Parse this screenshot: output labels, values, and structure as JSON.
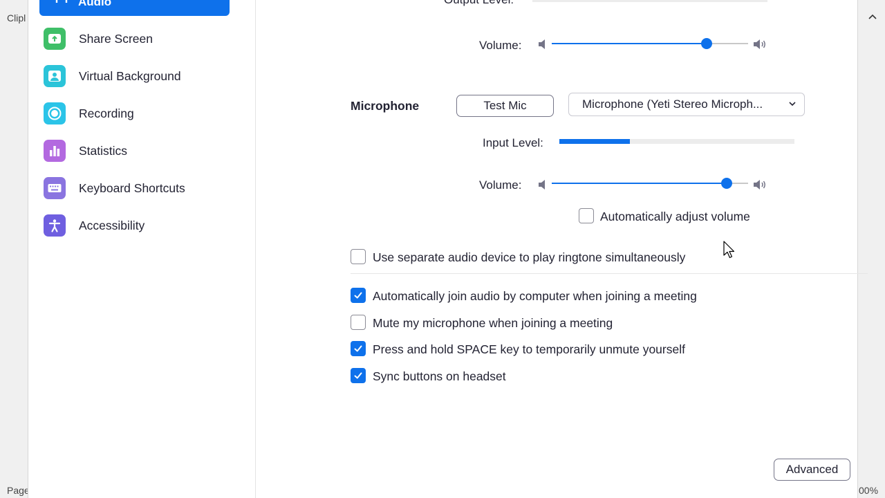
{
  "background": {
    "clip_text": "Clipl",
    "page_text": "Page",
    "zoom_text": "00%"
  },
  "sidebar": {
    "active": {
      "label": "Audio"
    },
    "items": [
      {
        "label": "Share Screen",
        "icon": "share-screen-icon",
        "color": "#3fbf68"
      },
      {
        "label": "Virtual Background",
        "icon": "virtual-background-icon",
        "color": "#2bc4d9"
      },
      {
        "label": "Recording",
        "icon": "recording-icon",
        "color": "#2bc4e8"
      },
      {
        "label": "Statistics",
        "icon": "statistics-icon",
        "color": "#b369e0"
      },
      {
        "label": "Keyboard Shortcuts",
        "icon": "keyboard-icon",
        "color": "#8a74e0"
      },
      {
        "label": "Accessibility",
        "icon": "accessibility-icon",
        "color": "#6f5fe0"
      }
    ]
  },
  "speaker": {
    "output_level_label": "Output Level:",
    "volume_label": "Volume:",
    "volume_value": 0.79
  },
  "microphone": {
    "title": "Microphone",
    "test_button": "Test Mic",
    "device": "Microphone (Yeti Stereo Microph...",
    "input_level_label": "Input Level:",
    "input_level_value": 0.3,
    "volume_label": "Volume:",
    "volume_value": 0.89,
    "auto_adjust_label": "Automatically adjust volume",
    "auto_adjust_checked": false
  },
  "options": {
    "ringtone": {
      "label": "Use separate audio device to play ringtone simultaneously",
      "checked": false
    },
    "auto_join": {
      "label": "Automatically join audio by computer when joining a meeting",
      "checked": true
    },
    "mute_on_join": {
      "label": "Mute my microphone when joining a meeting",
      "checked": false
    },
    "space_unmute": {
      "label": "Press and hold SPACE key to temporarily unmute yourself",
      "checked": true
    },
    "sync_headset": {
      "label": "Sync buttons on headset",
      "checked": true
    }
  },
  "advanced_button": "Advanced",
  "colors": {
    "accent": "#0e71eb"
  }
}
